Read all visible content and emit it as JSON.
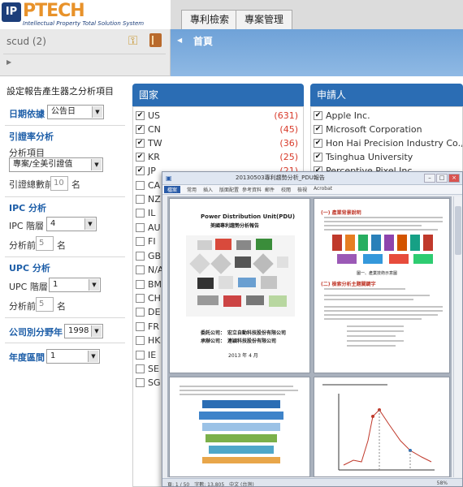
{
  "header": {
    "logo_mark": "IP",
    "logo_text": "PTECH",
    "logo_subtitle": "Intellectual Property Total Solution System",
    "tabs": [
      {
        "label": "專利檢索"
      },
      {
        "label": "專案管理"
      }
    ]
  },
  "user_panel": {
    "label": "scud (2)",
    "key_icon": "key-icon",
    "book_icon": "book-icon"
  },
  "blue_bar": {
    "home_tab": "首頁"
  },
  "form": {
    "title": "設定報告產生器之分析項目",
    "date_basis": {
      "label": "日期依據",
      "value": "公告日"
    },
    "citation": {
      "section": "引證率分析",
      "item_label": "分析項目",
      "item_value": "專案/全美引證值",
      "total_label": "引證總數前",
      "total_value": "10",
      "unit": "名"
    },
    "ipc": {
      "section": "IPC 分析",
      "level_label": "IPC 階層",
      "level_value": "4",
      "top_label": "分析前",
      "top_value": "5",
      "unit": "名"
    },
    "upc": {
      "section": "UPC 分析",
      "level_label": "UPC 階層",
      "level_value": "1",
      "top_label": "分析前",
      "top_value": "5",
      "unit": "名"
    },
    "company_year": {
      "label": "公司別分野年",
      "value": "1998"
    },
    "year_range": {
      "label": "年度區間",
      "value": "1"
    }
  },
  "country_panel": {
    "title": "國家",
    "rows": [
      {
        "name": "US",
        "count": "(631)",
        "checked": "✔"
      },
      {
        "name": "CN",
        "count": "(45)",
        "checked": "✔"
      },
      {
        "name": "TW",
        "count": "(36)",
        "checked": "✔"
      },
      {
        "name": "KR",
        "count": "(25)",
        "checked": "✔"
      },
      {
        "name": "JP",
        "count": "(21)",
        "checked": "✔"
      },
      {
        "name": "CA",
        "count": "",
        "checked": ""
      },
      {
        "name": "NZ",
        "count": "",
        "checked": ""
      },
      {
        "name": "IL",
        "count": "",
        "checked": ""
      },
      {
        "name": "AU",
        "count": "",
        "checked": ""
      },
      {
        "name": "FI",
        "count": "",
        "checked": ""
      },
      {
        "name": "GB",
        "count": "",
        "checked": ""
      },
      {
        "name": "N/A",
        "count": "",
        "checked": ""
      },
      {
        "name": "BM",
        "count": "",
        "checked": ""
      },
      {
        "name": "CH",
        "count": "",
        "checked": ""
      },
      {
        "name": "DE",
        "count": "",
        "checked": ""
      },
      {
        "name": "FR",
        "count": "",
        "checked": ""
      },
      {
        "name": "HK",
        "count": "",
        "checked": ""
      },
      {
        "name": "IE",
        "count": "",
        "checked": ""
      },
      {
        "name": "SE",
        "count": "",
        "checked": ""
      },
      {
        "name": "SG",
        "count": "",
        "checked": ""
      }
    ]
  },
  "applicant_panel": {
    "title": "申請人",
    "rows": [
      {
        "name": "Apple Inc.",
        "checked": "✔"
      },
      {
        "name": "Microsoft Corporation",
        "checked": "✔"
      },
      {
        "name": "Hon Hai Precision Industry Co., Ltd.",
        "checked": "✔"
      },
      {
        "name": "Tsinghua University",
        "checked": "✔"
      },
      {
        "name": "Perceptive Pixel Inc.",
        "checked": "✔"
      }
    ]
  },
  "document_window": {
    "title": "20130503專利趨勢分析_PDU報告",
    "ribbon_tabs": [
      "檔案",
      "常用",
      "插入",
      "版面配置",
      "參考資料",
      "郵件",
      "校閱",
      "檢視",
      "Acrobat"
    ],
    "page1": {
      "title": "Power Distribution Unit(PDU)",
      "subtitle": "美國專利趨勢分析報告",
      "org1": "委託公司：　宏立自動科技股份有限公司",
      "org2": "承辦公司：　連穎科技股份有限公司",
      "date": "2013 年 4 月"
    },
    "page2": {
      "section1": "(一) 產業背景說明",
      "section2": "(二) 檢索分析主題關鍵字",
      "caption": "圖一、產業技術示意圖"
    },
    "status": "頁: 1 / 50　字數: 13,805　中文 (台灣)",
    "zoom": "58%"
  }
}
